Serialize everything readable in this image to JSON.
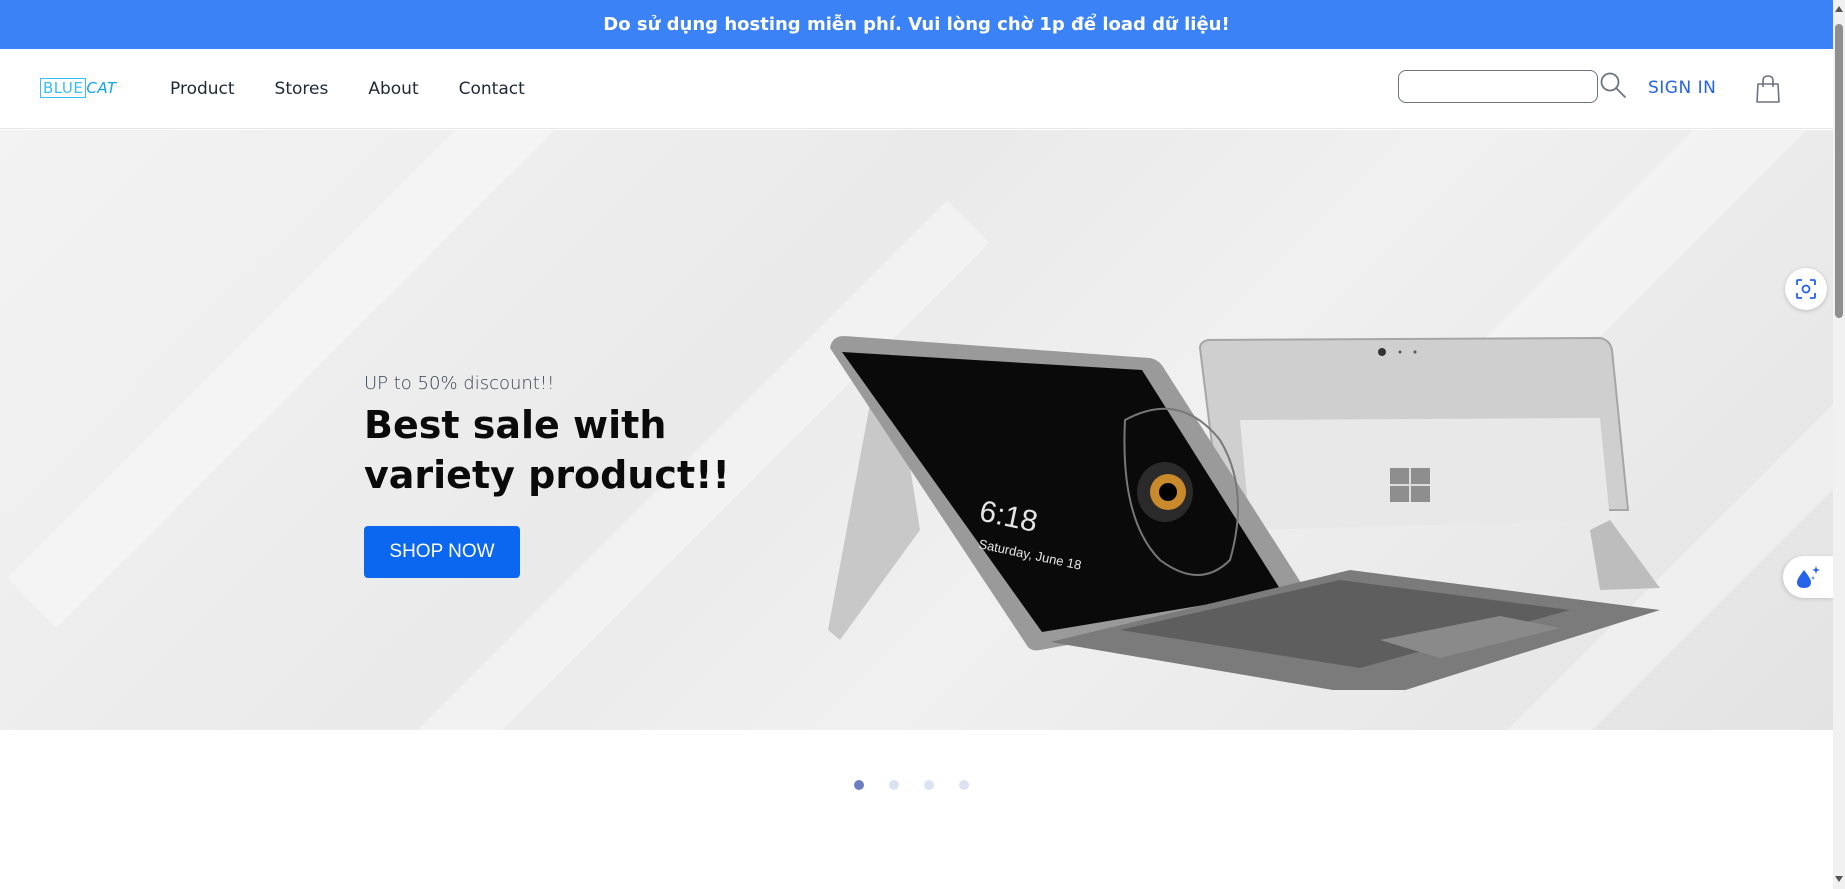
{
  "notice": {
    "text": "Do sử dụng hosting miễn phí. Vui lòng chờ 1p để load dữ liệu!"
  },
  "header": {
    "logo": {
      "part1": "BLUE",
      "part2": "CAT"
    },
    "nav": [
      {
        "label": "Product"
      },
      {
        "label": "Stores"
      },
      {
        "label": "About"
      },
      {
        "label": "Contact"
      }
    ],
    "search": {
      "placeholder": "",
      "value": ""
    },
    "sign_in_label": "SIGN IN"
  },
  "hero": {
    "subtitle": "UP to 50% discount!!",
    "headline": "Best sale with variety product!!",
    "cta_label": "SHOP NOW",
    "screen_time": "6:18",
    "screen_date": "Saturday, June 18"
  },
  "carousel": {
    "slide_count": 4,
    "active_index": 0
  },
  "colors": {
    "banner": "#3b82f6",
    "primary_button": "#0b66f0",
    "link": "#2563eb",
    "dot_active": "#6b7fc0",
    "dot_inactive": "#dbe3f3"
  },
  "icons": {
    "search": "search-icon",
    "cart": "shopping-bag-icon",
    "scan": "scan-icon",
    "drop": "water-drop-icon"
  }
}
